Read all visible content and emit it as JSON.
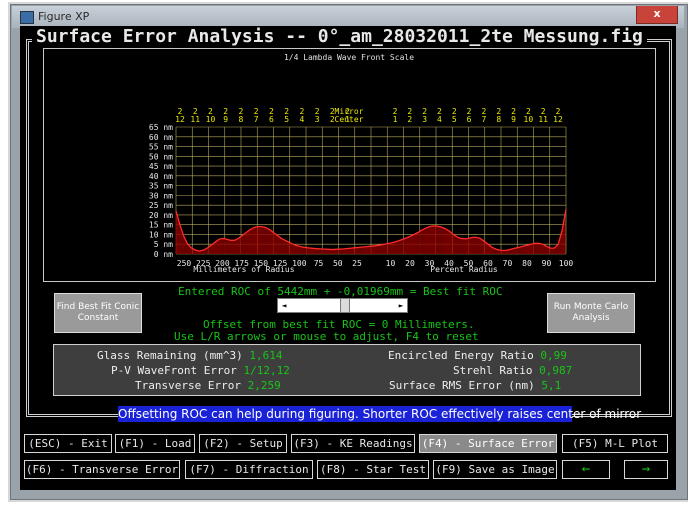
{
  "window": {
    "title": "Figure XP",
    "close_label": "x"
  },
  "app": {
    "title": "Surface Error Analysis -- 0°_am_28032011_2te Messung.fig"
  },
  "chart_data": {
    "type": "line",
    "title": "1/4 Lambda Wave Front Scale",
    "y_unit": "nm",
    "y_ticks": [
      "65 nm",
      "60 nm",
      "55 nm",
      "50 nm",
      "45 nm",
      "40 nm",
      "35 nm",
      "30 nm",
      "25 nm",
      "20 nm",
      "15 nm",
      "10 nm",
      "5 nm",
      "0 nm"
    ],
    "ylim": [
      0,
      65
    ],
    "mm_ticks": [
      "250",
      "225",
      "200",
      "175",
      "150",
      "125",
      "100",
      "75",
      "50",
      "25"
    ],
    "pct_ticks": [
      "10",
      "20",
      "30",
      "40",
      "50",
      "60",
      "70",
      "80",
      "90",
      "100"
    ],
    "xlabel_left": "Millimeters of Radius",
    "xlabel_right": "Percent Radius",
    "mirror_center_label": [
      "Mirror",
      "Center"
    ],
    "zone_labels_left": [
      "12",
      "11",
      "10",
      "9",
      "8",
      "7",
      "6",
      "5",
      "4",
      "3",
      "2",
      "1"
    ],
    "zone_labels_right": [
      "1",
      "2",
      "3",
      "4",
      "5",
      "6",
      "7",
      "8",
      "9",
      "10",
      "11",
      "12"
    ],
    "zone_label_top": "2",
    "grid": true,
    "series": [
      {
        "x": [
          -100,
          -98,
          -96,
          -94,
          -92,
          -90,
          -88,
          -86,
          -84,
          -82,
          -80,
          -78,
          -76,
          -74,
          -72,
          -70,
          -68,
          -66,
          -64,
          -62,
          -60,
          -58,
          -56,
          -54,
          -52,
          -50,
          -48,
          -46,
          -44,
          -42,
          -40,
          -38,
          -36,
          -34,
          -32,
          -30,
          -28,
          -26,
          -24,
          -22,
          -20,
          -18,
          -16,
          -14,
          -12,
          -10,
          -8,
          -6,
          -4,
          -2,
          0,
          2,
          4,
          6,
          8,
          10,
          12,
          14,
          16,
          18,
          20,
          22,
          24,
          26,
          28,
          30,
          32,
          34,
          36,
          38,
          40,
          42,
          44,
          46,
          48,
          50,
          52,
          54,
          56,
          58,
          60,
          62,
          64,
          66,
          68,
          70,
          72,
          74,
          76,
          78,
          80,
          82,
          84,
          86,
          88,
          90,
          92,
          94,
          96,
          98,
          100
        ],
        "y": [
          22,
          15,
          9,
          5,
          3,
          2,
          1.5,
          2,
          3,
          4.5,
          6,
          7.5,
          8,
          7.5,
          7,
          7,
          8,
          9.5,
          11,
          12.5,
          13.5,
          14,
          14,
          13.5,
          12.5,
          11,
          9.5,
          8,
          7,
          6,
          5,
          4.3,
          3.8,
          3.4,
          3.1,
          2.9,
          2.7,
          2.6,
          2.5,
          2.4,
          2.3,
          2.4,
          2.5,
          2.6,
          2.8,
          3,
          3.2,
          3.4,
          3.6,
          3.8,
          4,
          4.2,
          4.5,
          4.8,
          5.2,
          5.6,
          6.1,
          6.7,
          7.4,
          8.2,
          9,
          10,
          11,
          12.2,
          13.2,
          14,
          14.4,
          14.3,
          13.8,
          13,
          11.8,
          10.2,
          8.8,
          8,
          7.8,
          8,
          8.5,
          8.5,
          8,
          6.5,
          5,
          3.5,
          2.5,
          2,
          1.8,
          2,
          2.5,
          3,
          3.5,
          4,
          4.5,
          5,
          5.5,
          5.5,
          5,
          4,
          3,
          3,
          5,
          12,
          23
        ]
      }
    ]
  },
  "roc": {
    "line1": "Entered ROC of 5442mm + -0,01969mm = Best fit ROC",
    "line2": "Offset from best fit ROC = 0 Millimeters.",
    "line3": "Use L/R arrows or mouse to adjust, F4 to reset",
    "scroll_left": "◄",
    "scroll_right": "►",
    "position": 0.5
  },
  "buttons": {
    "fit_conic": "Find Best Fit Conic Constant",
    "monte_carlo": "Run Monte Carlo Analysis"
  },
  "stats": {
    "glass_label": "Glass Remaining (mm^3)",
    "glass_value": "1,614",
    "pv_label": "P-V WaveFront Error",
    "pv_value": "1/12,12",
    "trans_label": "Transverse Error",
    "trans_value": "2,259",
    "ee_label": "Encircled Energy Ratio",
    "ee_value": "0,99",
    "strehl_label": "Strehl Ratio",
    "strehl_value": "0,987",
    "rms_label": "Surface RMS Error (nm)",
    "rms_value": "5,1"
  },
  "info": "Offsetting ROC can help during figuring. Shorter ROC effectively raises center of mirror",
  "fkeys": {
    "exit": "(ESC) - Exit",
    "load": "(F1) - Load",
    "setup": "(F2) - Setup",
    "ke": "(F3) - KE Readings",
    "surface": "(F4) - Surface Error",
    "ml": "(F5) M-L Plot",
    "transverse": "(F6) - Transverse Error",
    "diffraction": "(F7) - Diffraction",
    "startest": "(F8) - Star Test",
    "save": "(F9) Save as Image",
    "prev": "←",
    "next": "→"
  },
  "colors": {
    "curve": "#ff2a2a",
    "fill": "#8b0000",
    "grid": "#b6a85c",
    "text_yellow": "#e8e800",
    "green": "#17c417",
    "info_bg": "#1a22d8"
  }
}
